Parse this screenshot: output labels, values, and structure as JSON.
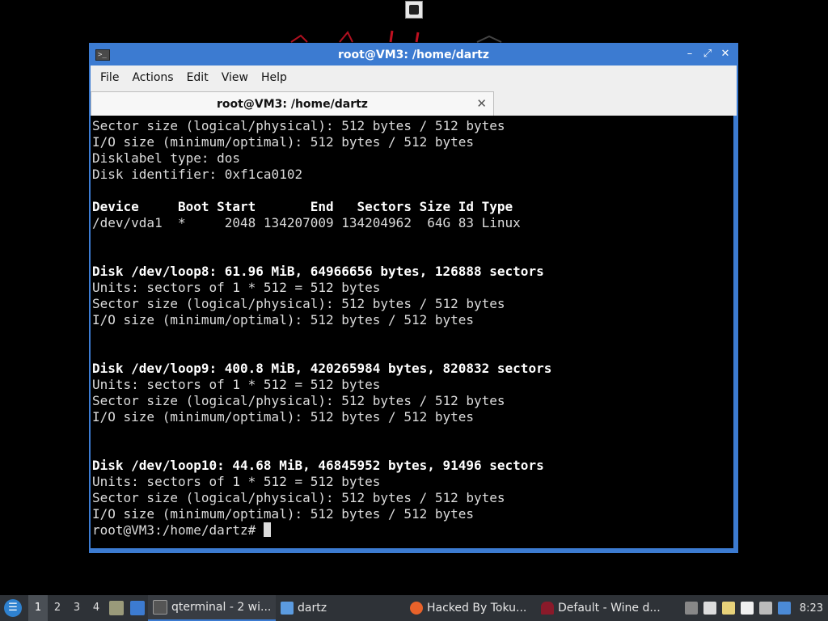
{
  "window": {
    "title": "root@VM3: /home/dartz"
  },
  "menubar": {
    "items": [
      "File",
      "Actions",
      "Edit",
      "View",
      "Help"
    ]
  },
  "tab": {
    "label": "root@VM3: /home/dartz",
    "close": "✕"
  },
  "terminal": {
    "lines": [
      {
        "text": "Sector size (logical/physical): 512 bytes / 512 bytes",
        "bold": false
      },
      {
        "text": "I/O size (minimum/optimal): 512 bytes / 512 bytes",
        "bold": false
      },
      {
        "text": "Disklabel type: dos",
        "bold": false
      },
      {
        "text": "Disk identifier: 0xf1ca0102",
        "bold": false
      },
      {
        "text": "",
        "bold": false
      },
      {
        "text": "Device     Boot Start       End   Sectors Size Id Type",
        "bold": true
      },
      {
        "text": "/dev/vda1  *     2048 134207009 134204962  64G 83 Linux",
        "bold": false
      },
      {
        "text": "",
        "bold": false
      },
      {
        "text": "",
        "bold": false
      },
      {
        "text": "Disk /dev/loop8: 61.96 MiB, 64966656 bytes, 126888 sectors",
        "bold": true
      },
      {
        "text": "Units: sectors of 1 * 512 = 512 bytes",
        "bold": false
      },
      {
        "text": "Sector size (logical/physical): 512 bytes / 512 bytes",
        "bold": false
      },
      {
        "text": "I/O size (minimum/optimal): 512 bytes / 512 bytes",
        "bold": false
      },
      {
        "text": "",
        "bold": false
      },
      {
        "text": "",
        "bold": false
      },
      {
        "text": "Disk /dev/loop9: 400.8 MiB, 420265984 bytes, 820832 sectors",
        "bold": true
      },
      {
        "text": "Units: sectors of 1 * 512 = 512 bytes",
        "bold": false
      },
      {
        "text": "Sector size (logical/physical): 512 bytes / 512 bytes",
        "bold": false
      },
      {
        "text": "I/O size (minimum/optimal): 512 bytes / 512 bytes",
        "bold": false
      },
      {
        "text": "",
        "bold": false
      },
      {
        "text": "",
        "bold": false
      },
      {
        "text": "Disk /dev/loop10: 44.68 MiB, 46845952 bytes, 91496 sectors",
        "bold": true
      },
      {
        "text": "Units: sectors of 1 * 512 = 512 bytes",
        "bold": false
      },
      {
        "text": "Sector size (logical/physical): 512 bytes / 512 bytes",
        "bold": false
      },
      {
        "text": "I/O size (minimum/optimal): 512 bytes / 512 bytes",
        "bold": false
      }
    ],
    "prompt": "root@VM3:/home/dartz# "
  },
  "taskbar": {
    "workspaces": [
      "1",
      "2",
      "3",
      "4"
    ],
    "tasks": [
      {
        "label": "qterminal - 2 wi...",
        "icon": "terminal-icon",
        "active": true
      },
      {
        "label": "dartz",
        "icon": "folder-icon",
        "active": false
      },
      {
        "label": "Hacked By Toku...",
        "icon": "firefox-icon",
        "active": false
      },
      {
        "label": "Default - Wine d...",
        "icon": "wine-icon",
        "active": false
      }
    ],
    "clock": "8:23"
  },
  "colors": {
    "accent": "#3c7bd1",
    "terminal_bg": "#000000",
    "taskbar_bg": "#2e3237"
  }
}
